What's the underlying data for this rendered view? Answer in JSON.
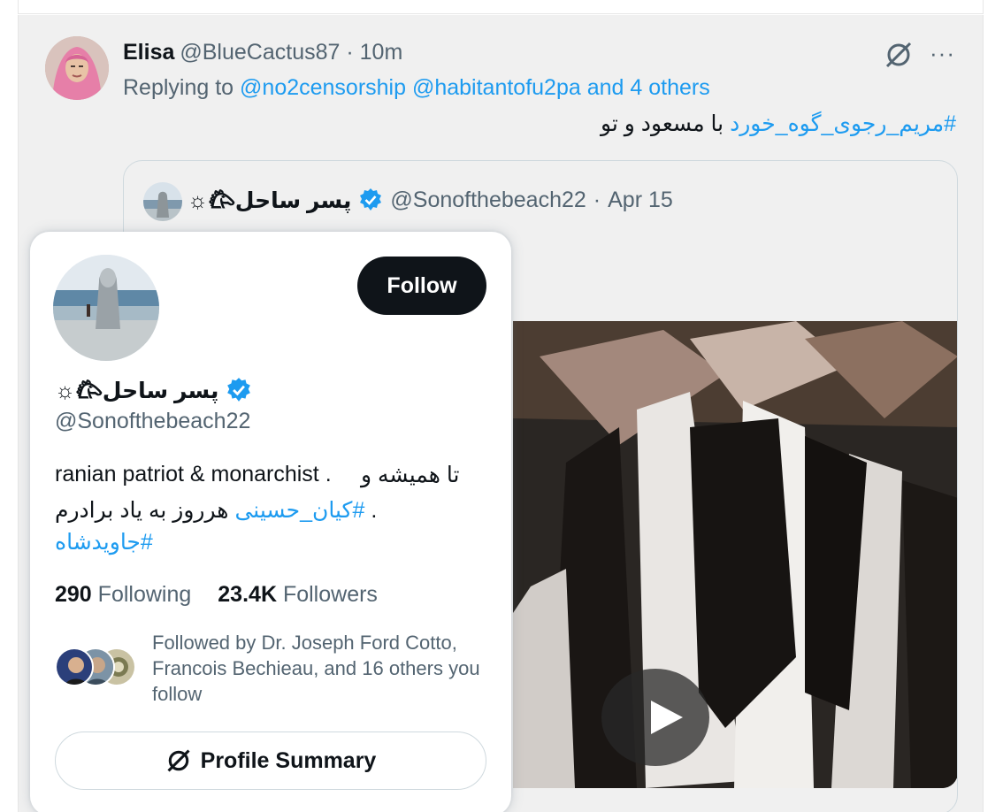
{
  "tweet": {
    "author_name": "Elisa",
    "author_handle": "@BlueCactus87",
    "separator": "·",
    "time": "10m",
    "replying_prefix": "Replying to",
    "reply_handles": "@no2censorship @habitantofu2pa and 4 others",
    "text_hashtag": "#مریم_رجوی_گوه_خورد",
    "text_plain": "با مسعود و تو",
    "more_label": "···"
  },
  "quote": {
    "name": "☼𐂃پسر ساحل",
    "handle": "@Sonofthebeach22",
    "separator": "·",
    "date": "Apr 15"
  },
  "hover_card": {
    "follow_label": "Follow",
    "name": "☼𐂃پسر ساحل",
    "handle": "@Sonofthebeach22",
    "bio_line1_en": "ranian patriot & monarchist .",
    "bio_line1_fa": "تا همیشه و",
    "bio_line2_hashtag": "#کیان_حسینی",
    "bio_line2_text": "هرروز به یاد برادرم",
    "bio_line2_dot": ".",
    "bio_line3_hashtag": "#جاویدشاه",
    "following_count": "290",
    "following_label": "Following",
    "followers_count": "23.4K",
    "followers_label": "Followers",
    "followed_by": "Followed by Dr. Joseph Ford Cotto, Francois Bechieau, and 16 others you follow",
    "summary_label": "Profile Summary"
  },
  "colors": {
    "accent": "#1d9bf0",
    "muted": "#536471",
    "text": "#0f1419",
    "verified": "#1d9bf0"
  }
}
